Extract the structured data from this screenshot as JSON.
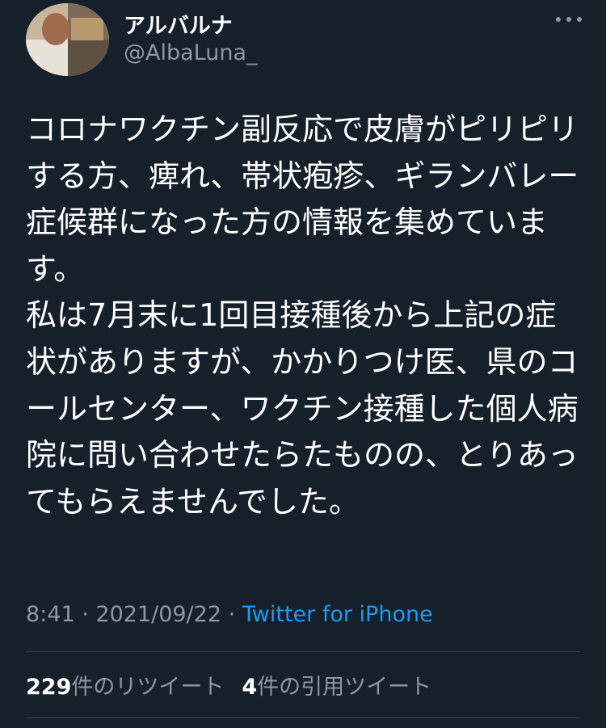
{
  "tweet": {
    "author": {
      "display_name": "アルバルナ",
      "username": "@AlbaLuna_"
    },
    "more_icon": "more-horizontal-icon",
    "text": "コロナワクチン副反応で皮膚がピリピリする方、痺れ、帯状疱疹、ギランバレー症候群になった方の情報を集めています。\n私は7月末に1回目接種後から上記の症状がありますが、かかりつけ医、県のコールセンター、ワクチン接種した個人病院に問い合わせたらたものの、とりあってもらえませんでした。",
    "time": "8:41",
    "date": "2021/09/22",
    "separator": " · ",
    "source": "Twitter for iPhone"
  },
  "stats": {
    "retweets": {
      "count": "229",
      "label": "件のリツイート"
    },
    "quotes": {
      "count": "4",
      "label": "件の引用ツイート"
    }
  },
  "colors": {
    "background": "#15202b",
    "text": "#ffffff",
    "secondary_text": "#8b98a5",
    "link": "#1d9bf0",
    "divider": "#38444d"
  }
}
